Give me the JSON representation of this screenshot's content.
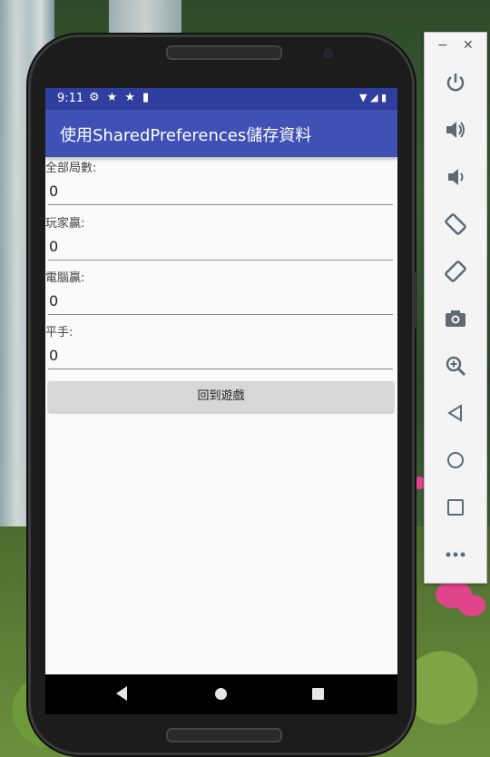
{
  "status_bar": {
    "time": "9:11",
    "left_icons": [
      "gear-icon",
      "star-icon",
      "star-icon",
      "sd-card-icon"
    ],
    "right_icons": [
      "wifi-icon",
      "signal-icon",
      "battery-icon"
    ]
  },
  "app_bar": {
    "title": "使用SharedPreferences儲存資料",
    "color": "#3f51b5",
    "status_color": "#303f9f"
  },
  "stats": [
    {
      "label": "全部局數:",
      "value": "0"
    },
    {
      "label": "玩家贏:",
      "value": "0"
    },
    {
      "label": "電腦贏:",
      "value": "0"
    },
    {
      "label": "平手:",
      "value": "0"
    }
  ],
  "back_button": {
    "label": "回到遊戲"
  },
  "nav_bar": {
    "items": [
      "back",
      "home",
      "recents"
    ]
  },
  "emulator_panel": {
    "window_controls": [
      "minimize",
      "close"
    ],
    "controls": [
      "power",
      "volume-up",
      "volume-down",
      "rotate-left",
      "rotate-right",
      "screenshot",
      "zoom",
      "back",
      "home",
      "overview",
      "more"
    ]
  }
}
